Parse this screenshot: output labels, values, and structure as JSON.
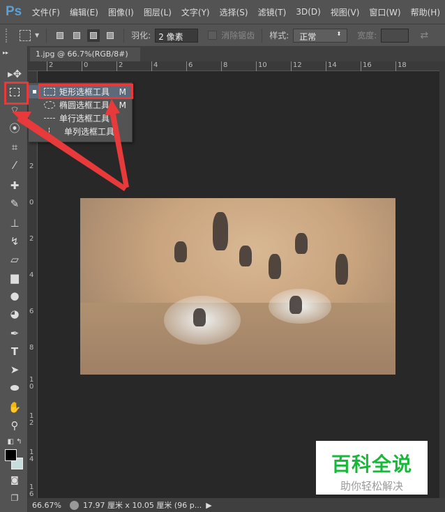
{
  "app": {
    "logo": "Ps"
  },
  "menu": [
    "文件(F)",
    "编辑(E)",
    "图像(I)",
    "图层(L)",
    "文字(Y)",
    "选择(S)",
    "滤镜(T)",
    "3D(D)",
    "视图(V)",
    "窗口(W)",
    "帮助(H)"
  ],
  "options": {
    "feather_label": "羽化:",
    "feather_value": "2 像素",
    "antialias_label": "消除锯齿",
    "style_label": "样式:",
    "style_value": "正常",
    "width_label": "宽度:"
  },
  "tab": {
    "title": "1.jpg @ 66.7%(RGB/8#)",
    "close": "×"
  },
  "ruler": {
    "h": [
      "2",
      "0",
      "2",
      "4",
      "6",
      "8",
      "10",
      "12",
      "14",
      "16",
      "18"
    ],
    "v": [
      "2",
      "0",
      "2",
      "4",
      "6",
      "8",
      "10",
      "12",
      "14",
      "16"
    ]
  },
  "flyout": [
    {
      "label": "矩形选框工具",
      "key": "M"
    },
    {
      "label": "椭圆选框工具",
      "key": "M"
    },
    {
      "label": "单行选框工具",
      "key": ""
    },
    {
      "label": "单列选框工具",
      "key": ""
    }
  ],
  "status": {
    "zoom": "66.67%",
    "info": "17.97 厘米 x 10.05 厘米 (96 p..."
  },
  "watermark": {
    "title": "百科全说",
    "subtitle": "助你轻松解决"
  },
  "colors": {
    "accent": "#e83a3a",
    "bg": "#282828",
    "panel": "#535353"
  }
}
